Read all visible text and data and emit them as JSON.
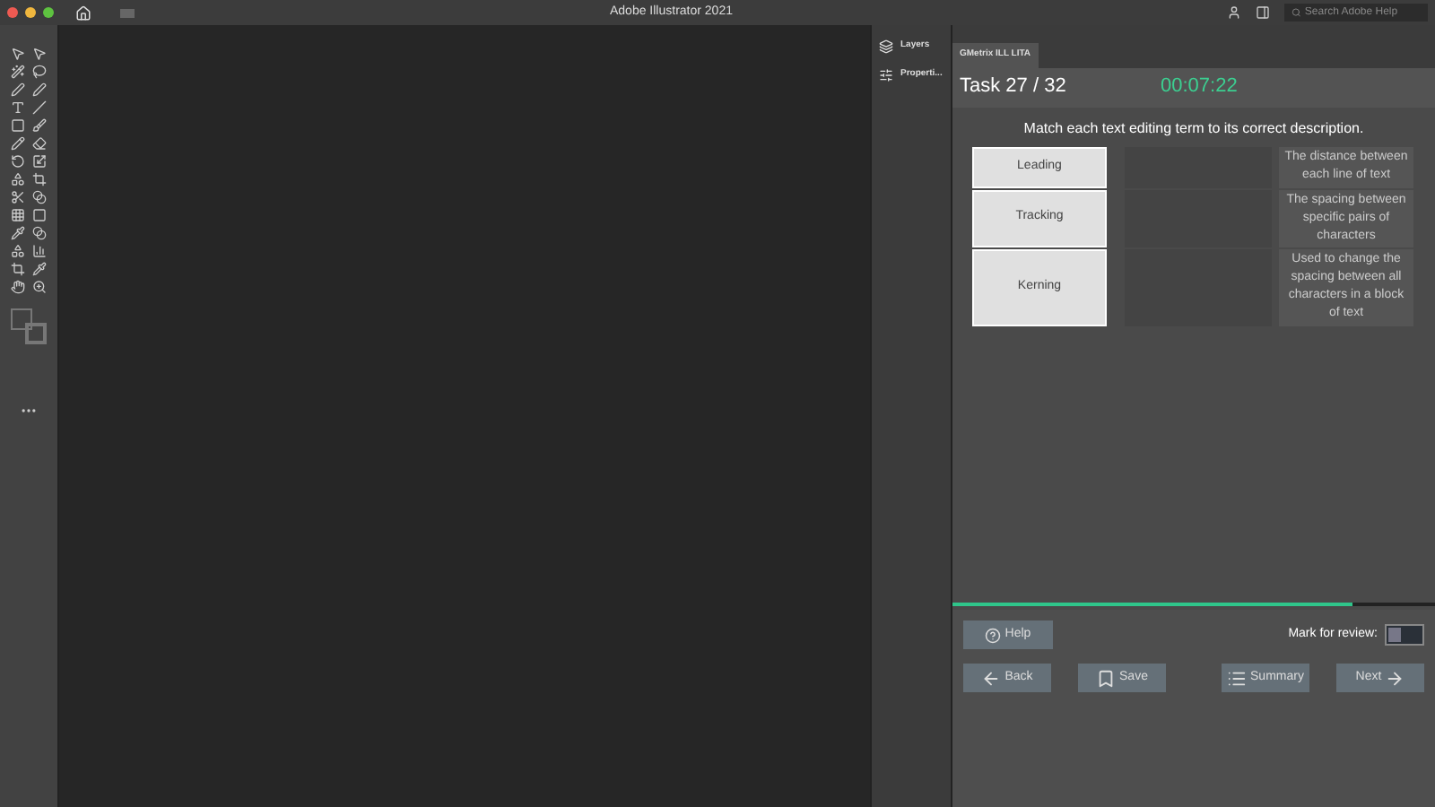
{
  "window": {
    "title": "Adobe Illustrator 2021"
  },
  "search": {
    "placeholder": "Search Adobe Help"
  },
  "panels": [
    {
      "label": "Layers",
      "kind": "layers"
    },
    {
      "label": "Properti...",
      "kind": "properties"
    }
  ],
  "tab": {
    "label": "GMetrix ILL LITA",
    "selected": true
  },
  "task": {
    "label": "Task 27 / 32",
    "timer": "00:07:22"
  },
  "question": "Match each text editing term to its correct description.",
  "pairs": [
    {
      "term": "Leading",
      "description": "The distance between each line of text"
    },
    {
      "term": "Tracking",
      "description": "The spacing between specific pairs of characters"
    },
    {
      "term": "Kerning",
      "description": "Used to change the spacing between all characters in a block of text"
    }
  ],
  "progress": {
    "level": 0.83
  },
  "help": "Help",
  "review": {
    "label": "Mark for review:",
    "on": false
  },
  "nav": [
    {
      "label": "Back",
      "kind": "back"
    },
    {
      "label": "Save",
      "kind": "save"
    },
    {
      "label": "Summary",
      "kind": "summary"
    },
    {
      "label": "Next",
      "kind": "next"
    }
  ]
}
